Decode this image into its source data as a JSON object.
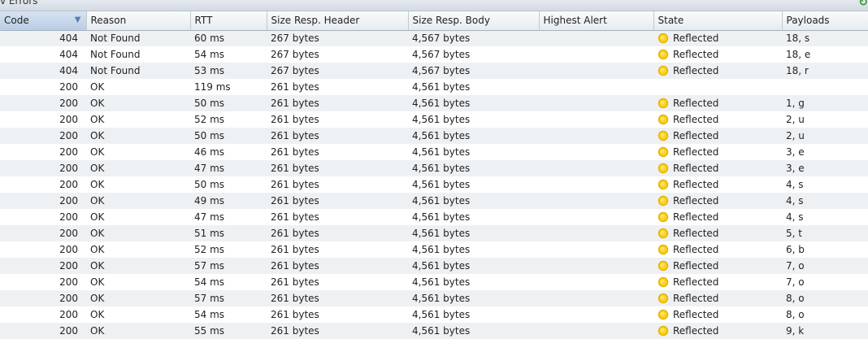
{
  "panel": {
    "title": "v Errors"
  },
  "table": {
    "headers": [
      "Code",
      "Reason",
      "RTT",
      "Size Resp. Header",
      "Size Resp. Body",
      "Highest Alert",
      "State",
      "Payloads"
    ],
    "rows": [
      {
        "code": "404",
        "reason": "Not Found",
        "rtt": "60 ms",
        "header": "267 bytes",
        "body": "4,567 bytes",
        "alert": "",
        "state": "Reflected",
        "payloads": "18, s"
      },
      {
        "code": "404",
        "reason": "Not Found",
        "rtt": "54 ms",
        "header": "267 bytes",
        "body": "4,567 bytes",
        "alert": "",
        "state": "Reflected",
        "payloads": "18, e"
      },
      {
        "code": "404",
        "reason": "Not Found",
        "rtt": "53 ms",
        "header": "267 bytes",
        "body": "4,567 bytes",
        "alert": "",
        "state": "Reflected",
        "payloads": "18, r"
      },
      {
        "code": "200",
        "reason": "OK",
        "rtt": "119 ms",
        "header": "261 bytes",
        "body": "4,561 bytes",
        "alert": "",
        "state": "",
        "payloads": ""
      },
      {
        "code": "200",
        "reason": "OK",
        "rtt": "50 ms",
        "header": "261 bytes",
        "body": "4,561 bytes",
        "alert": "",
        "state": "Reflected",
        "payloads": "1, g"
      },
      {
        "code": "200",
        "reason": "OK",
        "rtt": "52 ms",
        "header": "261 bytes",
        "body": "4,561 bytes",
        "alert": "",
        "state": "Reflected",
        "payloads": "2, u"
      },
      {
        "code": "200",
        "reason": "OK",
        "rtt": "50 ms",
        "header": "261 bytes",
        "body": "4,561 bytes",
        "alert": "",
        "state": "Reflected",
        "payloads": "2, u"
      },
      {
        "code": "200",
        "reason": "OK",
        "rtt": "46 ms",
        "header": "261 bytes",
        "body": "4,561 bytes",
        "alert": "",
        "state": "Reflected",
        "payloads": "3, e"
      },
      {
        "code": "200",
        "reason": "OK",
        "rtt": "47 ms",
        "header": "261 bytes",
        "body": "4,561 bytes",
        "alert": "",
        "state": "Reflected",
        "payloads": "3, e"
      },
      {
        "code": "200",
        "reason": "OK",
        "rtt": "50 ms",
        "header": "261 bytes",
        "body": "4,561 bytes",
        "alert": "",
        "state": "Reflected",
        "payloads": "4, s"
      },
      {
        "code": "200",
        "reason": "OK",
        "rtt": "49 ms",
        "header": "261 bytes",
        "body": "4,561 bytes",
        "alert": "",
        "state": "Reflected",
        "payloads": "4, s"
      },
      {
        "code": "200",
        "reason": "OK",
        "rtt": "47 ms",
        "header": "261 bytes",
        "body": "4,561 bytes",
        "alert": "",
        "state": "Reflected",
        "payloads": "4, s"
      },
      {
        "code": "200",
        "reason": "OK",
        "rtt": "51 ms",
        "header": "261 bytes",
        "body": "4,561 bytes",
        "alert": "",
        "state": "Reflected",
        "payloads": "5, t"
      },
      {
        "code": "200",
        "reason": "OK",
        "rtt": "52 ms",
        "header": "261 bytes",
        "body": "4,561 bytes",
        "alert": "",
        "state": "Reflected",
        "payloads": "6, b"
      },
      {
        "code": "200",
        "reason": "OK",
        "rtt": "57 ms",
        "header": "261 bytes",
        "body": "4,561 bytes",
        "alert": "",
        "state": "Reflected",
        "payloads": "7, o"
      },
      {
        "code": "200",
        "reason": "OK",
        "rtt": "54 ms",
        "header": "261 bytes",
        "body": "4,561 bytes",
        "alert": "",
        "state": "Reflected",
        "payloads": "7, o"
      },
      {
        "code": "200",
        "reason": "OK",
        "rtt": "57 ms",
        "header": "261 bytes",
        "body": "4,561 bytes",
        "alert": "",
        "state": "Reflected",
        "payloads": "8, o"
      },
      {
        "code": "200",
        "reason": "OK",
        "rtt": "54 ms",
        "header": "261 bytes",
        "body": "4,561 bytes",
        "alert": "",
        "state": "Reflected",
        "payloads": "8, o"
      },
      {
        "code": "200",
        "reason": "OK",
        "rtt": "55 ms",
        "header": "261 bytes",
        "body": "4,561 bytes",
        "alert": "",
        "state": "Reflected",
        "payloads": "9, k"
      }
    ]
  },
  "icons": {
    "state": "sun-icon",
    "refresh": "refresh-icon",
    "sort": "sort-descending-icon"
  },
  "colors": {
    "sun_outer": "#e8b400",
    "sun_inner": "#ffe56a",
    "alt_row": "#eef1f4",
    "sorted_header": "#c5d6ea"
  }
}
